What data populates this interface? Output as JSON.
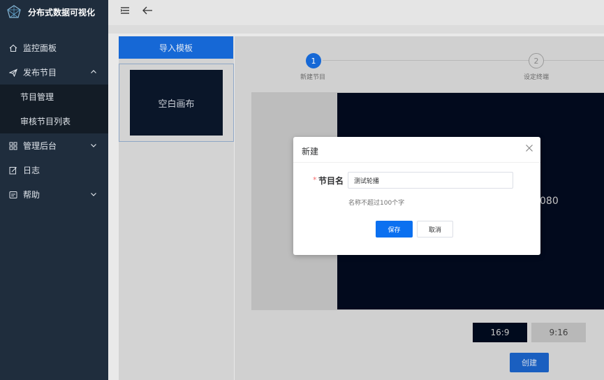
{
  "app": {
    "title": "分布式数据可视化"
  },
  "sidebar": {
    "items": [
      {
        "label": "监控面板",
        "icon": "home-icon"
      },
      {
        "label": "发布节目",
        "icon": "send-icon",
        "expanded": true
      },
      {
        "label": "节目管理",
        "sub": true
      },
      {
        "label": "审核节目列表",
        "sub": true
      },
      {
        "label": "管理后台",
        "icon": "grid-icon",
        "expanded": false
      },
      {
        "label": "日志",
        "icon": "edit-icon"
      },
      {
        "label": "帮助",
        "icon": "help-icon",
        "expanded": false
      }
    ]
  },
  "left_panel": {
    "import_label": "导入模板",
    "template_label": "空白画布"
  },
  "steps": [
    {
      "number": "1",
      "label": "新建节目",
      "active": true
    },
    {
      "number": "2",
      "label": "设定终端",
      "active": false
    }
  ],
  "canvas": {
    "resolution_fragment": "080"
  },
  "ratios": [
    {
      "label": "16:9",
      "selected": true
    },
    {
      "label": "9:16",
      "selected": false
    }
  ],
  "create_label": "创建",
  "modal": {
    "title": "新建",
    "required_mark": "*",
    "field_label": "节目名",
    "field_value": "测试轮播",
    "hint": "名称不超过100个字",
    "save_label": "保存",
    "cancel_label": "取消"
  },
  "colors": {
    "accent": "#1668d6",
    "sidebar_bg": "#1f2d3d",
    "canvas_dark": "#020a1d"
  }
}
